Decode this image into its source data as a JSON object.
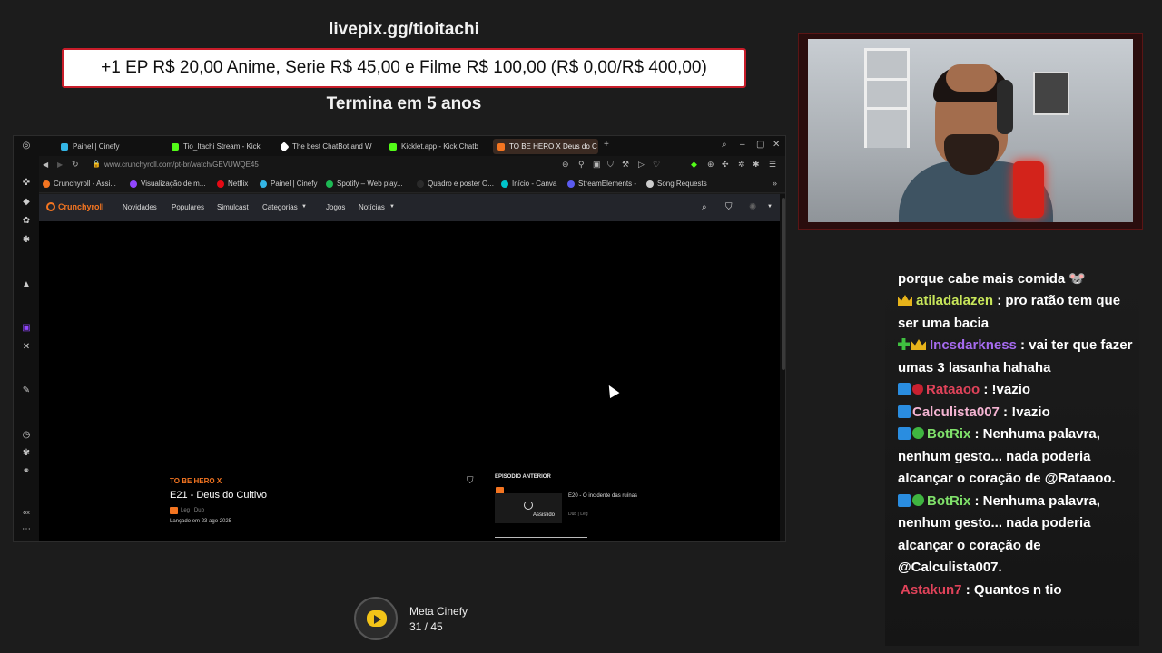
{
  "overlay": {
    "livepix": "livepix.gg/tioitachi",
    "goal_text": "+1 EP R$ 20,00 Anime, Serie R$ 45,00 e Filme R$ 100,00 (R$ 0,00/R$ 400,00)",
    "ends": "Termina em 5 anos"
  },
  "browser": {
    "tabs": [
      {
        "label": "Painel | Cinefy",
        "color": "#33b5e5"
      },
      {
        "label": "Tio_Itachi Stream - Kick",
        "color": "#53fc18"
      },
      {
        "label": "The best ChatBot and W",
        "color": "#ffffff"
      },
      {
        "label": "Kicklet.app - Kick Chatb",
        "color": "#53fc18"
      },
      {
        "label": "TO BE HERO X Deus do C",
        "color": "#f47521"
      }
    ],
    "url": "www.crunchyroll.com/pt-br/watch/GEVUWQE45",
    "bookmarks": [
      {
        "label": "Crunchyroll - Assi...",
        "color": "#f47521"
      },
      {
        "label": "Visualização de m...",
        "color": "#9146ff"
      },
      {
        "label": "Netflix",
        "color": "#e50914"
      },
      {
        "label": "Painel | Cinefy",
        "color": "#33b5e5"
      },
      {
        "label": "Spotify – Web play...",
        "color": "#1db954"
      },
      {
        "label": "Quadro e poster O...",
        "color": "#aaaaaa"
      },
      {
        "label": "Início - Canva",
        "color": "#00c4cc"
      },
      {
        "label": "StreamElements -",
        "color": "#5b5bf0"
      },
      {
        "label": "Song Requests",
        "color": "#cccccc"
      }
    ]
  },
  "crunchyroll": {
    "logo": "Crunchyroll",
    "nav": [
      "Novidades",
      "Populares",
      "Simulcast",
      "Categorias",
      "Jogos",
      "Notícias"
    ],
    "series": "TO BE HERO X",
    "episode_title": "E21 - Deus do Cultivo",
    "episode_lang": "Leg | Dub",
    "episode_date": "Lançado em 23 ago 2025",
    "prev_header": "EPISÓDIO ANTERIOR",
    "prev_title": "E20 - O incidente das ruínas",
    "prev_lang": "Dub | Leg",
    "prev_watched": "Assistido"
  },
  "chat": {
    "messages": [
      {
        "name": "",
        "name_color": "#ffffff",
        "text": "porque cabe mais comida 🐭",
        "badges": []
      },
      {
        "name": "atiladalazen",
        "name_color": "#c8e65a",
        "text": " : pro ratão tem que ser uma bacia",
        "badges": [
          "crown"
        ]
      },
      {
        "name": "Incsdarkness",
        "name_color": "#a66bf0",
        "text": " : vai ter que fazer umas 3 lasanha hahaha",
        "badges": [
          "plus",
          "crown"
        ]
      },
      {
        "name": "Rataaoo",
        "name_color": "#e0435a",
        "text": " : !vazio",
        "badges": [
          "sq",
          "red"
        ]
      },
      {
        "name": "Calculista007",
        "name_color": "#f4b4d2",
        "text": " : !vazio",
        "badges": [
          "sq"
        ]
      },
      {
        "name": "BotRix",
        "name_color": "#7fe06a",
        "text": " : Nenhuma palavra, nenhum gesto... nada poderia alcançar o coração de @Rataaoo.",
        "badges": [
          "sq",
          "check"
        ]
      },
      {
        "name": "BotRix",
        "name_color": "#7fe06a",
        "text": " : Nenhuma palavra, nenhum gesto... nada poderia alcançar o coração de @Calculista007.",
        "badges": [
          "sq",
          "check"
        ]
      },
      {
        "name": "Astakun7",
        "name_color": "#e0435a",
        "text": " : Quantos n tio",
        "badges": []
      }
    ]
  },
  "meta": {
    "label": "Meta Cinefy",
    "count": "31 / 45"
  }
}
